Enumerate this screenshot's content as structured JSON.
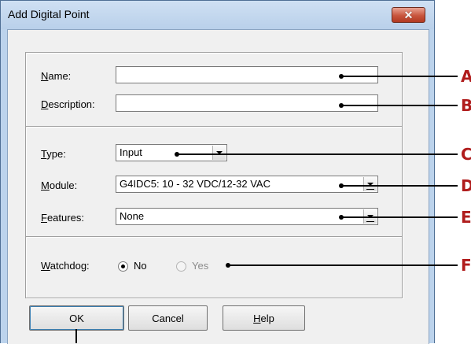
{
  "window": {
    "title": "Add Digital Point",
    "close_glyph": "✕"
  },
  "fields": {
    "name": {
      "label_mn": "N",
      "label_rest": "ame:",
      "value": ""
    },
    "description": {
      "label_mn": "D",
      "label_rest": "escription:",
      "value": ""
    },
    "type": {
      "label_mn": "T",
      "label_rest": "ype:",
      "value": "Input"
    },
    "module": {
      "label_mn": "M",
      "label_rest": "odule:",
      "value": "G4IDC5: 10 - 32 VDC/12-32 VAC"
    },
    "features": {
      "label_mn": "F",
      "label_rest": "eatures:",
      "value": "None"
    }
  },
  "watchdog": {
    "label_mn": "W",
    "label_rest": "atchdog:",
    "options": [
      "No",
      "Yes"
    ],
    "selected": "No"
  },
  "buttons": {
    "ok": "OK",
    "cancel": "Cancel",
    "help_mn": "H",
    "help_rest": "elp"
  },
  "callouts": [
    "A",
    "B",
    "C",
    "D",
    "E",
    "F"
  ],
  "icons": {
    "dropdown": "chevron-down-icon",
    "close": "close-icon"
  },
  "colors": {
    "callout_letter": "#b01c1c",
    "close_button": "#c8553d",
    "title_bar": "#bcd3ec"
  }
}
